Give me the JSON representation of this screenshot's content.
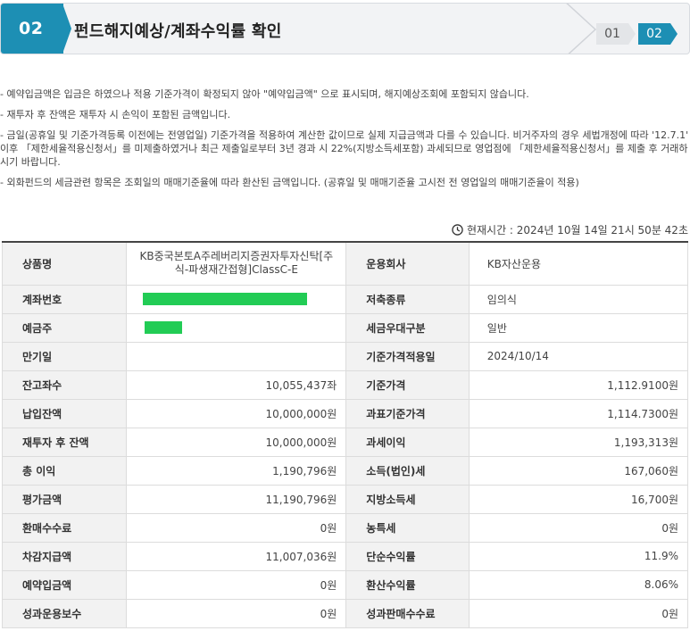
{
  "header": {
    "step_number": "02",
    "title": "펀드해지예상/계좌수익률 확인",
    "nav_steps": [
      "01",
      "02"
    ]
  },
  "notes": [
    "- 예약입금액은 입금은 하였으나 적용 기준가격이 확정되지 않아 \"예약입금액\" 으로 표시되며, 해지예상조회에 포함되지 않습니다.",
    "- 재투자 후 잔액은 재투자 시 손익이 포함된 금액입니다.",
    "- 금일(공휴일 및 기준가격등록 이전에는 전영업일) 기준가격을 적용하여 계산한 값이므로 실제 지급금액과 다를 수 있습니다. 비거주자의 경우 세법개정에 따라 '12.7.1' 이후 「제한세율적용신청서」를 미제출하였거나 최근 제출일로부터 3년 경과 시 22%(지방소득세포함) 과세되므로 영업점에 「제한세율적용신청서」를 제출 후 거래하시기 바랍니다.",
    "- 외화펀드의 세금관련 항목은 조회일의 매매기준율에 따라 환산된 금액입니다. (공휴일 및 매매기준율 고시전 전 영업일의 매매기준율이 적용)"
  ],
  "current_time": "현재시간 : 2024년 10월 14일 21시 50분 42초",
  "table": {
    "rows": [
      {
        "l1": "상품명",
        "v1": "KB중국본토A주레버리지증권자투자신탁[주식-파생재간접형]ClassC-E",
        "l2": "운용회사",
        "v2": "KB자산운용"
      },
      {
        "l1": "계좌번호",
        "v1": "",
        "l2": "저축종류",
        "v2": "임의식"
      },
      {
        "l1": "예금주",
        "v1": "",
        "l2": "세금우대구분",
        "v2": "일반"
      },
      {
        "l1": "만기일",
        "v1": "",
        "l2": "기준가격적용일",
        "v2": "2024/10/14"
      },
      {
        "l1": "잔고좌수",
        "v1": "10,055,437좌",
        "l2": "기준가격",
        "v2": "1,112.9100원"
      },
      {
        "l1": "납입잔액",
        "v1": "10,000,000원",
        "l2": "과표기준가격",
        "v2": "1,114.7300원"
      },
      {
        "l1": "재투자 후 잔액",
        "v1": "10,000,000원",
        "l2": "과세이익",
        "v2": "1,193,313원"
      },
      {
        "l1": "총 이익",
        "v1": "1,190,796원",
        "l2": "소득(법인)세",
        "v2": "167,060원"
      },
      {
        "l1": "평가금액",
        "v1": "11,190,796원",
        "l2": "지방소득세",
        "v2": "16,700원"
      },
      {
        "l1": "환매수수료",
        "v1": "0원",
        "l2": "농특세",
        "v2": "0원"
      },
      {
        "l1": "차감지급액",
        "v1": "11,007,036원",
        "l2": "단순수익률",
        "v2": "11.9%"
      },
      {
        "l1": "예약입금액",
        "v1": "0원",
        "l2": "환산수익률",
        "v2": "8.06%"
      },
      {
        "l1": "성과운용보수",
        "v1": "0원",
        "l2": "성과판매수수료",
        "v2": "0원"
      }
    ]
  },
  "colors": {
    "accent": "#1d8fb4",
    "mask": "#22cc55"
  }
}
